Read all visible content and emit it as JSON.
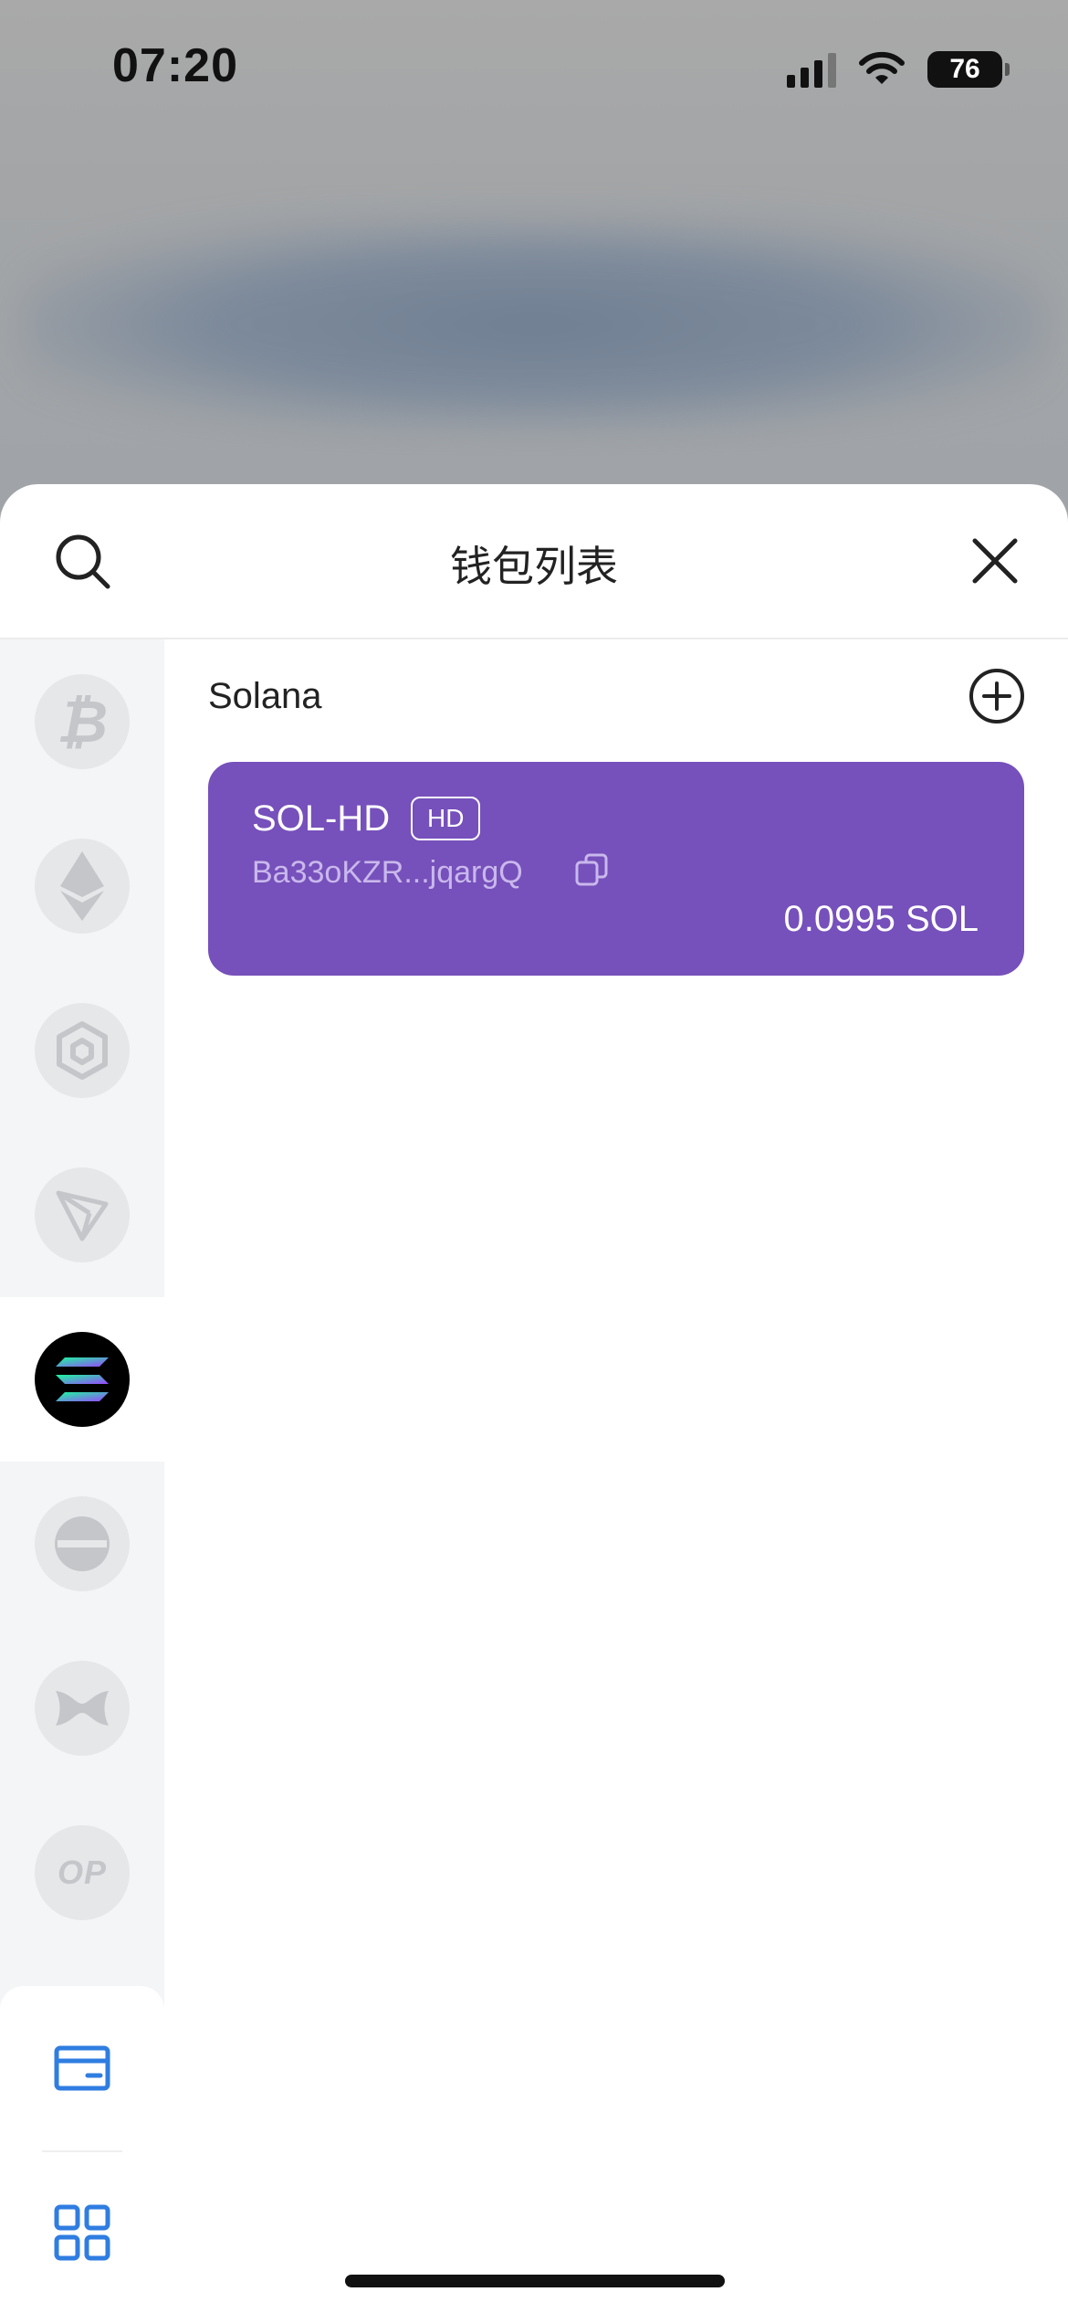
{
  "status_bar": {
    "time": "07:20",
    "battery": "76"
  },
  "header": {
    "title": "钱包列表"
  },
  "chains": [
    {
      "name": "bitcoin",
      "icon": "bitcoin-icon",
      "selected": false
    },
    {
      "name": "ethereum",
      "icon": "ethereum-icon",
      "selected": false
    },
    {
      "name": "bnb",
      "icon": "bnb-chain-icon",
      "selected": false
    },
    {
      "name": "tron",
      "icon": "tron-icon",
      "selected": false
    },
    {
      "name": "solana",
      "icon": "solana-icon",
      "selected": true
    },
    {
      "name": "ethereum-classic",
      "icon": "minus-circle-chain-icon",
      "selected": false
    },
    {
      "name": "other-chain",
      "icon": "wave-chain-icon",
      "selected": false
    },
    {
      "name": "optimism",
      "icon": "optimism-icon",
      "label": "OP",
      "selected": false
    }
  ],
  "rail_bottom": {
    "icons": [
      "wallet-card-icon",
      "grid-apps-icon"
    ],
    "accent": "#2f7de1"
  },
  "section": {
    "title": "Solana"
  },
  "wallets": [
    {
      "name": "SOL-HD",
      "badge": "HD",
      "address": "Ba33oKZR...jqargQ",
      "balance": "0.0995 SOL",
      "color": "#7650bb"
    }
  ]
}
